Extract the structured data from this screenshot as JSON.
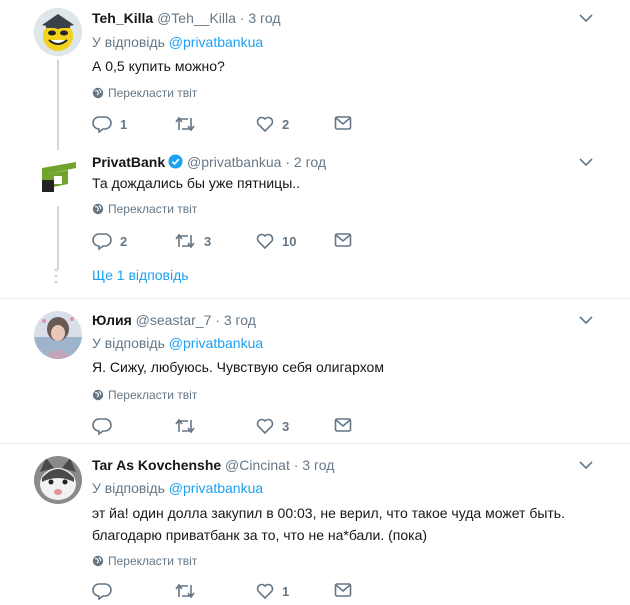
{
  "tweets": [
    {
      "name": "Teh_Killa",
      "handle": "@Teh__Killa",
      "separator": "·",
      "time": "3 год",
      "reply_prefix": "У відповідь",
      "reply_mention": "@privatbankua",
      "text": "А 0,5 купить можно?",
      "translate": "Перекласти твіт",
      "replies": "1",
      "retweets": "",
      "likes": "2"
    },
    {
      "name": "PrivatBank",
      "verified": true,
      "handle": "@privatbankua",
      "separator": "·",
      "time": "2 год",
      "text": "Та дождались бы уже пятницы..",
      "translate": "Перекласти твіт",
      "replies": "2",
      "retweets": "3",
      "likes": "10",
      "more_replies": "Ще 1 відповідь"
    },
    {
      "name": "Юлия",
      "handle": "@seastar_7",
      "separator": "·",
      "time": "3 год",
      "reply_prefix": "У відповідь",
      "reply_mention": "@privatbankua",
      "text": "Я. Сижу, любуюсь. Чувствую себя олигархом",
      "translate": "Перекласти твіт",
      "replies": "",
      "retweets": "",
      "likes": "3"
    },
    {
      "name": "Tar As Kovchenshe",
      "handle": "@Cincinat",
      "separator": "·",
      "time": "3 год",
      "reply_prefix": "У відповідь",
      "reply_mention": "@privatbankua",
      "text_line1": "эт йа! один долла закупил в 00:03, не верил, что такое чуда может быть.",
      "text_line2": "благодарю приватбанк за то, что не на*бали. (пока)",
      "translate": "Перекласти твіт",
      "replies": "",
      "retweets": "",
      "likes": "1"
    }
  ],
  "colors": {
    "link": "#1da1f2",
    "muted": "#657786",
    "verified": "#1da1f2",
    "privatbank_green": "#6fa52d"
  }
}
